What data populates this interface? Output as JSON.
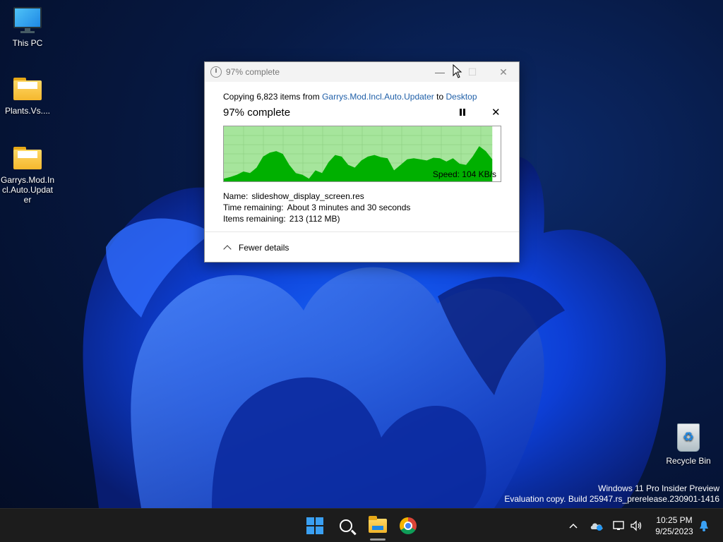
{
  "desktop": {
    "icons": [
      {
        "label": "This PC",
        "type": "computer"
      },
      {
        "label": "Plants.Vs....",
        "type": "folder"
      },
      {
        "label": "Garrys.Mod.Incl.Auto.Updater",
        "type": "folder"
      },
      {
        "label": "Recycle Bin",
        "type": "recycle-bin"
      }
    ],
    "watermark": {
      "line1": "Windows 11 Pro Insider Preview",
      "line2": "Evaluation copy. Build 25947.rs_prerelease.230901-1416"
    }
  },
  "dialog": {
    "title": "97% complete",
    "copy_prefix": "Copying 6,823 items from ",
    "source": "Garrys.Mod.Incl.Auto.Updater",
    "copy_to": " to ",
    "destination": "Desktop",
    "percent_label": "97% complete",
    "progress_fraction": 0.97,
    "speed_label": "Speed: 104 KB/s",
    "name_key": "Name:",
    "name_value": "slideshow_display_screen.res",
    "time_key": "Time remaining:",
    "time_value": "About 3 minutes and 30 seconds",
    "items_key": "Items remaining:",
    "items_value": "213 (112 MB)",
    "fewer_details": "Fewer details",
    "colors": {
      "graph_fill": "#00b000",
      "graph_bg": "#a6e59c",
      "link": "#1f5fa8"
    }
  },
  "taskbar": {
    "apps": [
      "start-icon",
      "search-icon",
      "file-explorer-icon",
      "chrome-icon"
    ],
    "tray_icons": [
      "chevron-up-icon",
      "onedrive-icon",
      "network-icon",
      "volume-icon",
      "notification-bell-icon"
    ],
    "time": "10:25 PM",
    "date": "9/25/2023"
  }
}
